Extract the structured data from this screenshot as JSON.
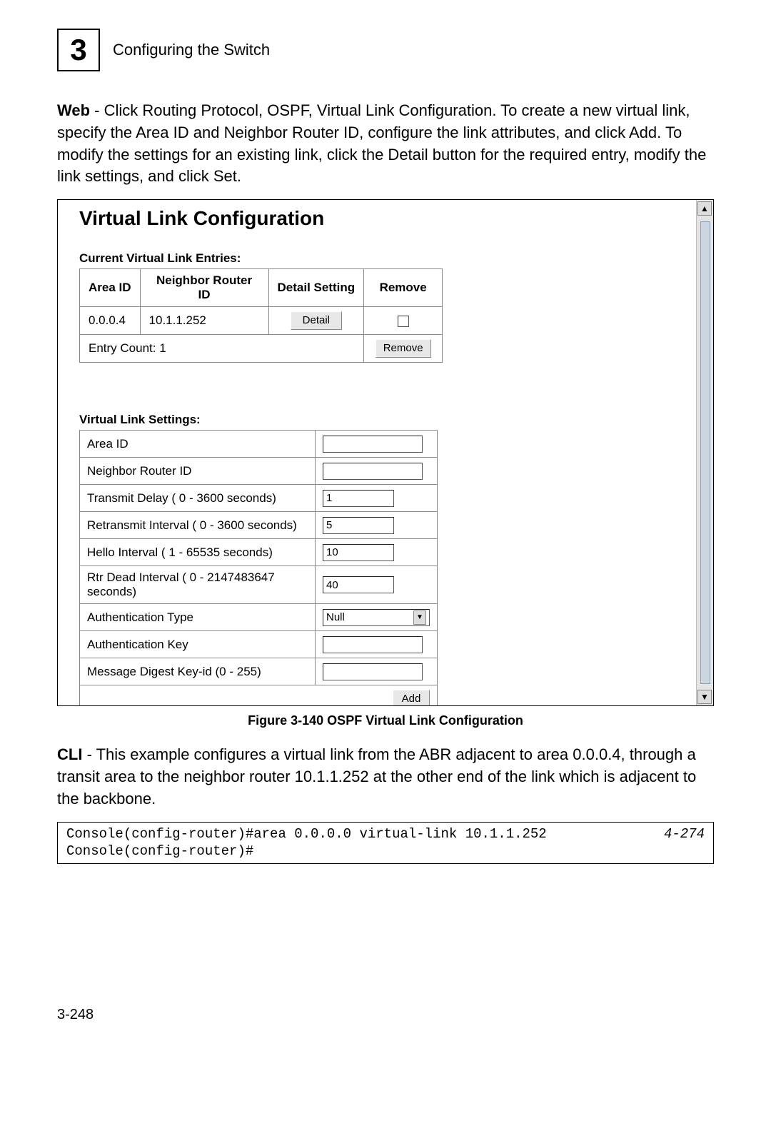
{
  "header": {
    "chapter_number": "3",
    "chapter_title": "Configuring the Switch"
  },
  "intro": {
    "lead_bold": "Web",
    "lead_rest": " - Click Routing Protocol, OSPF, Virtual Link Configuration. To create a new virtual link, specify the Area ID and Neighbor Router ID, configure the link attributes, and click Add. To modify the settings for an existing link, click the Detail button for the required entry, modify the link settings, and click Set."
  },
  "screenshot": {
    "title": "Virtual Link Configuration",
    "entries_label": "Current Virtual Link Entries:",
    "entries_headers": [
      "Area ID",
      "Neighbor Router ID",
      "Detail Setting",
      "Remove"
    ],
    "entries_row": {
      "area_id": "0.0.0.4",
      "neighbor": "10.1.1.252",
      "detail_btn": "Detail"
    },
    "entry_count_label": "Entry Count: 1",
    "remove_btn": "Remove",
    "settings_label": "Virtual Link Settings:",
    "settings_rows": [
      {
        "label": "Area ID",
        "value": ""
      },
      {
        "label": "Neighbor Router ID",
        "value": ""
      },
      {
        "label": "Transmit Delay ( 0 - 3600 seconds)",
        "value": "1"
      },
      {
        "label": "Retransmit Interval ( 0 - 3600 seconds)",
        "value": "5"
      },
      {
        "label": "Hello Interval ( 1 - 65535 seconds)",
        "value": "10"
      },
      {
        "label": "Rtr Dead Interval ( 0 - 2147483647 seconds)",
        "value": "40"
      },
      {
        "label": "Authentication Type",
        "value": "Null",
        "type": "select"
      },
      {
        "label": "Authentication Key",
        "value": ""
      },
      {
        "label": "Message Digest Key-id (0 - 255)",
        "value": ""
      }
    ],
    "add_btn": "Add"
  },
  "figure_caption": "Figure 3-140   OSPF Virtual Link Configuration",
  "cli_para": {
    "lead_bold": "CLI",
    "lead_rest": " - This example configures a virtual link from the ABR adjacent to area 0.0.0.4, through a transit area to the neighbor router 10.1.1.252 at the other end of the link which is adjacent to the backbone."
  },
  "cli_box": {
    "left": "Console(config-router)#area 0.0.0.0 virtual-link 10.1.1.252\nConsole(config-router)#",
    "right": "4-274"
  },
  "page_number": "3-248"
}
